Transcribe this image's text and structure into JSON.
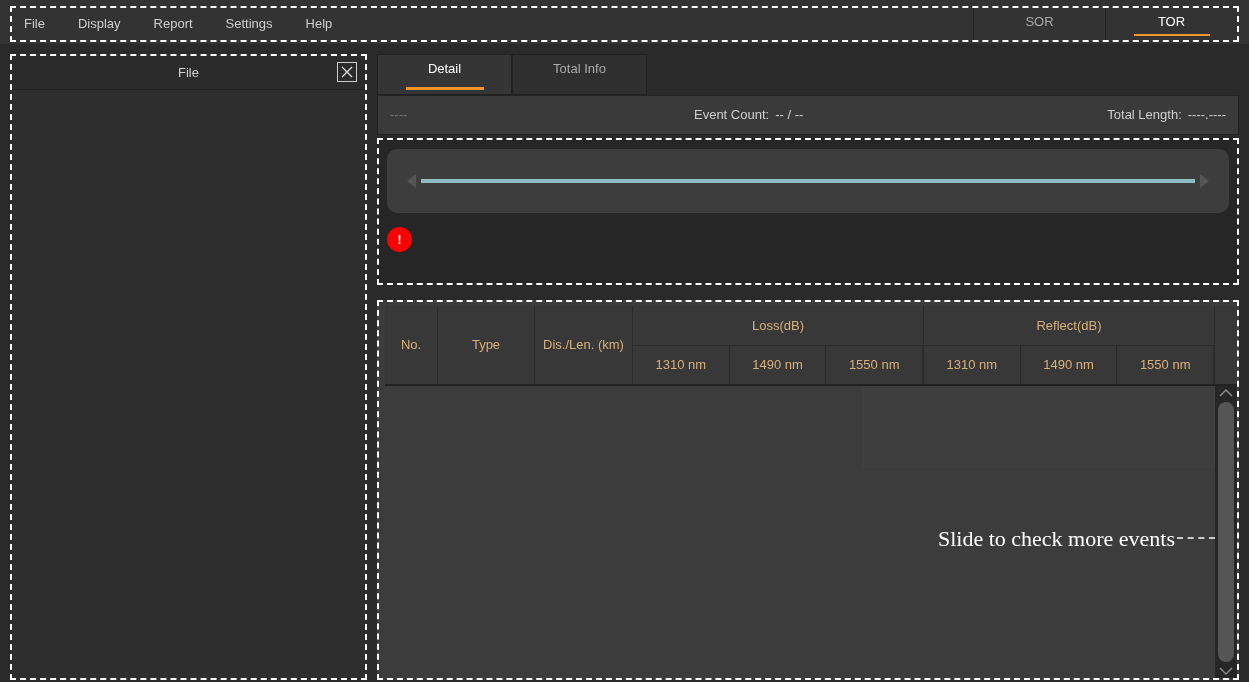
{
  "menu": [
    "File",
    "Display",
    "Report",
    "Settings",
    "Help"
  ],
  "mode_tabs": [
    {
      "label": "SOR",
      "selected": false
    },
    {
      "label": "TOR",
      "selected": true
    }
  ],
  "file_panel": {
    "title": "File"
  },
  "tabs": [
    {
      "label": "Detail",
      "selected": true
    },
    {
      "label": "Total Info",
      "selected": false
    }
  ],
  "info": {
    "name": "----",
    "event_count_label": "Event Count:",
    "event_count_value": "-- / --",
    "total_length_label": "Total Length:",
    "total_length_value": "----.----"
  },
  "trace": {
    "alert": "!"
  },
  "table": {
    "columns": [
      {
        "label": "No."
      },
      {
        "label": "Type"
      },
      {
        "label": "Dis./Len. (km)"
      },
      {
        "label": "Loss(dB)",
        "children": [
          "1310 nm",
          "1490 nm",
          "1550 nm"
        ]
      },
      {
        "label": "Reflect(dB)",
        "children": [
          "1310 nm",
          "1490 nm",
          "1550 nm"
        ]
      }
    ]
  },
  "annotation": "Slide to check more events"
}
